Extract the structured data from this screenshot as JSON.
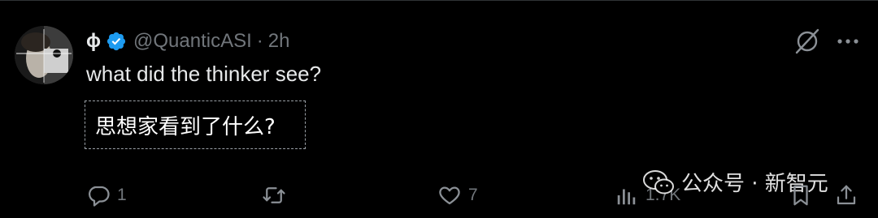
{
  "tweet": {
    "display_name": "ɸ",
    "handle": "@QuanticASI",
    "separator": "·",
    "time": "2h",
    "text": "what did the thinker see?",
    "translation": "思想家看到了什么?"
  },
  "actions": {
    "reply_count": "1",
    "retweet_count": "",
    "like_count": "7",
    "views_count": "1.7K"
  },
  "watermark": {
    "text": "公众号 · 新智元"
  },
  "colors": {
    "background": "#000000",
    "text": "#e7e9ea",
    "muted": "#71767b",
    "verified": "#1d9bf0"
  },
  "icons": [
    "verified-badge-icon",
    "grok-icon",
    "more-icon",
    "reply-icon",
    "retweet-icon",
    "like-icon",
    "views-icon",
    "bookmark-icon",
    "share-icon",
    "wechat-icon"
  ]
}
